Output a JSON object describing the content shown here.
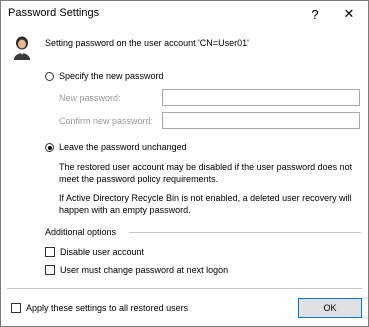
{
  "window": {
    "title": "Password Settings",
    "help": "?",
    "close": "✕"
  },
  "heading": "Setting password on the user account 'CN=User01'",
  "options": {
    "specify_label": "Specify the new password",
    "new_password_label": "New password:",
    "confirm_password_label": "Confirm new password:",
    "leave_label": "Leave the password unchanged"
  },
  "notes": {
    "disabled_note": "The restored user account may be disabled if the user password does not meet the password policy requirements.",
    "recycle_note": "If Active Directory Recycle Bin is not enabled, a deleted user recovery will happen with an empty password."
  },
  "additional": {
    "title": "Additional options",
    "disable_account": "Disable user account",
    "must_change": "User must change password at next logon"
  },
  "footer": {
    "apply_all": "Apply these settings to all restored users",
    "ok": "OK"
  }
}
